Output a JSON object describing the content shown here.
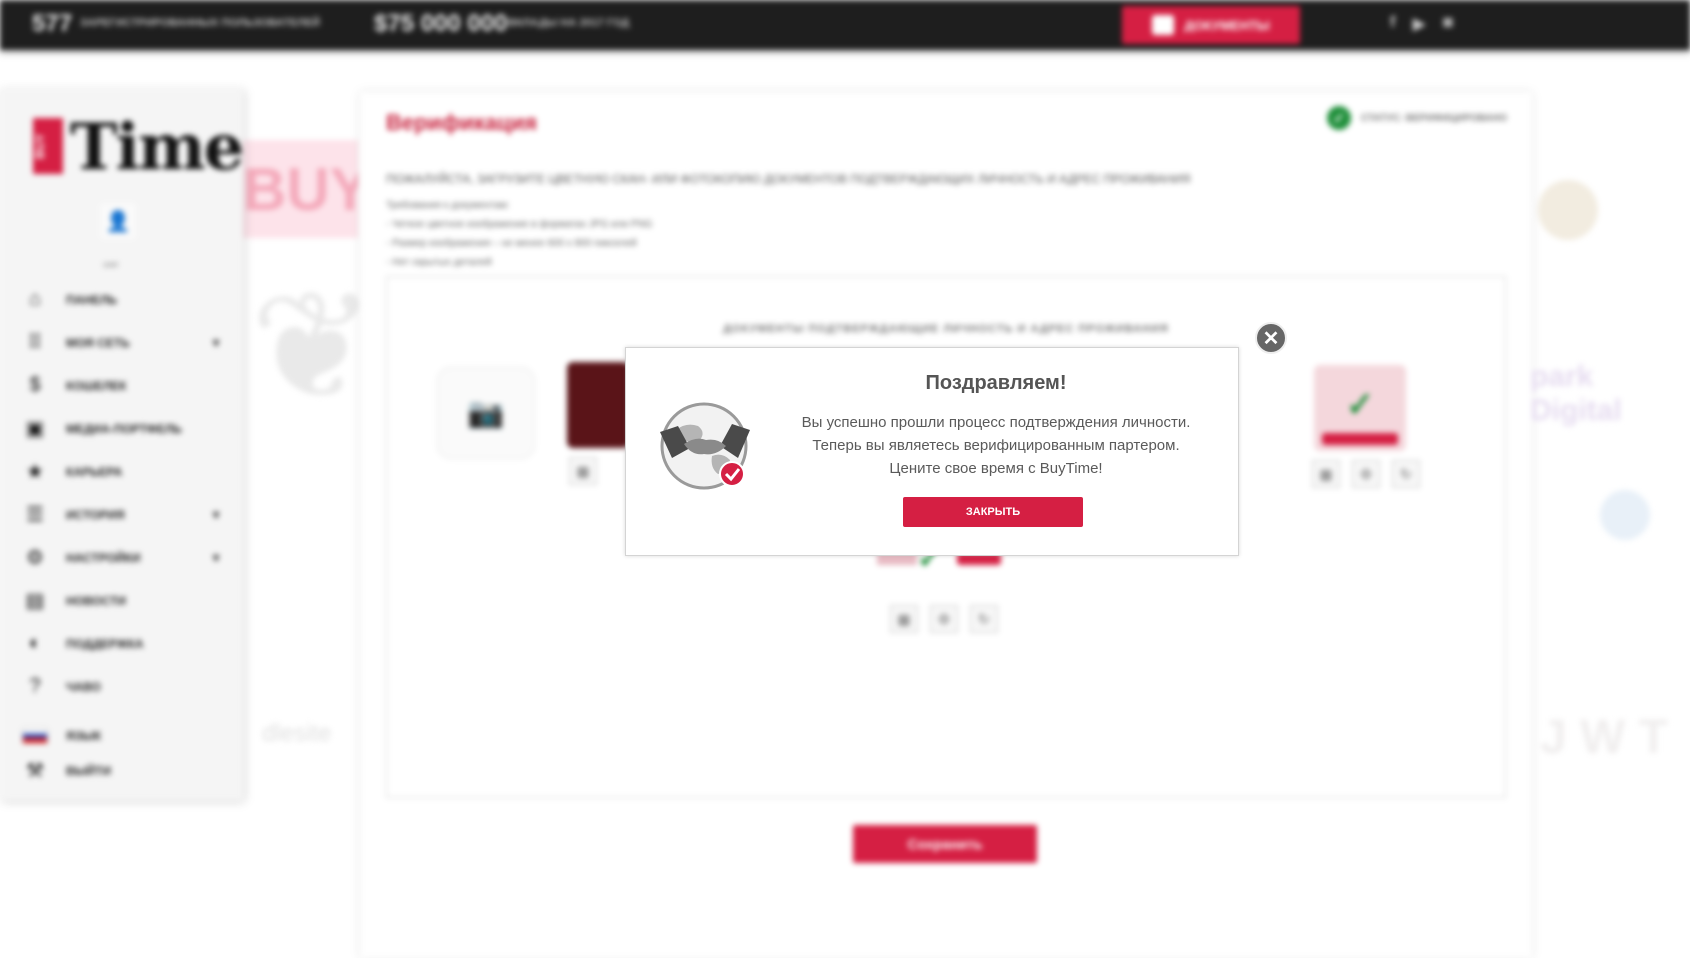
{
  "topbar": {
    "stats": [
      {
        "number": "577",
        "label": "ЗАРЕГИСТРИРОВАННЫХ ПОЛЬЗОВАТЕЛЕЙ"
      },
      {
        "number": "$75 000 000",
        "label": "ВКЛАДЫ НА 2017 ГОД"
      }
    ],
    "documents_label": "ДОКУМЕНТЫ",
    "social": [
      "f",
      "▶",
      "◙"
    ]
  },
  "sidebar": {
    "logo_buy": "BUY",
    "logo_time": "Time",
    "user_caption": "user",
    "items": [
      {
        "label": "ПАНЕЛЬ",
        "icon": "⌂"
      },
      {
        "label": "МОЯ СЕТЬ",
        "icon": "⠿"
      },
      {
        "label": "КОШЕЛЕК",
        "icon": "$"
      },
      {
        "label": "МЕДИА-ПОРТФЕЛЬ",
        "icon": "▣"
      },
      {
        "label": "КАРЬЕРА",
        "icon": "★"
      },
      {
        "label": "ИСТОРИЯ",
        "icon": "☰"
      },
      {
        "label": "НАСТРОЙКИ",
        "icon": "⚙"
      },
      {
        "label": "НОВОСТИ",
        "icon": "▤"
      },
      {
        "label": "ПОДДЕРЖКА",
        "icon": "◐"
      },
      {
        "label": "ЧАВО",
        "icon": "?"
      },
      {
        "label": "ЯЗЫК",
        "icon": ""
      },
      {
        "label": "ВЫЙТИ",
        "icon": "⚒"
      }
    ]
  },
  "main": {
    "title": "Верификация",
    "status_text": "СТАТУС: ВЕРИФИЦИРОВАНО",
    "instruction": "ПОЖАЛУЙСТА, ЗАГРУЗИТЕ ЦВЕТНУЮ СКАН- ИЛИ ФОТОКОПИЮ ДОКУМЕНТОВ ПОДТВЕРЖДАЮЩИХ ЛИЧНОСТЬ И АДРЕС ПРОЖИВАНИЯ",
    "requirements_title": "Требования к документам:",
    "requirements": [
      "- Четкое цветное изображение в форматах JPG или PNG",
      "- Размер изображения – не менее 600 х 800 пикселей",
      "- Нет скрытых деталей"
    ],
    "upload_title": "ДОКУМЕНТЫ ПОДТВЕРЖДАЮЩИЕ ЛИЧНОСТЬ И АДРЕС ПРОЖИВАНИЯ",
    "save_label": "Сохранить"
  },
  "watermarks": {
    "buy": "BUY",
    "dlesite": "dlesite",
    "spark": "park Digital",
    "jwt": "J W T"
  },
  "modal": {
    "title": "Поздравляем!",
    "lines": [
      "Вы успешно прошли процесс подтверждения личности.",
      "Теперь вы являетесь верифицированным партером.",
      "Цените свое время с BuyTime!"
    ],
    "close_label": "ЗАКРЫТЬ",
    "close_icon": "✕"
  },
  "colors": {
    "accent": "#d51f43",
    "success": "#1f8f3a",
    "topbar": "#1e1e1e"
  }
}
